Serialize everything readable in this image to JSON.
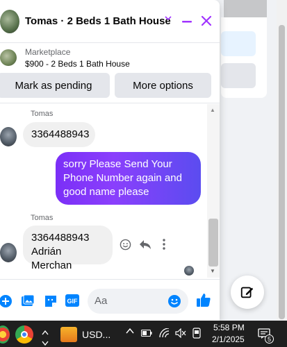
{
  "chat": {
    "title": "Tomas · 2 Beds 1 Bath House",
    "listing_source": "Marketplace",
    "listing_desc": "$900 - 2 Beds 1 Bath House",
    "mark_pending_label": "Mark as pending",
    "more_options_label": "More options"
  },
  "messages": {
    "sender1": "Tomas",
    "msg1": "3364488943",
    "outgoing": "sorry Please Send Your Phone Number again and good name please",
    "sender2": "Tomas",
    "msg2_line1": "3364488943",
    "msg2_line2": "Adrián Merchan"
  },
  "composer": {
    "placeholder": "Aa"
  },
  "taskbar": {
    "app_label": "USD...",
    "time": "5:58 PM",
    "date": "2/1/2025",
    "notification_count": "5"
  },
  "colors": {
    "accent": "#a033ff",
    "messenger_blue": "#0084ff",
    "outgoing_start": "#7b2ff7",
    "outgoing_end": "#5b4cf0"
  },
  "icons": [
    "minimize-icon",
    "close-icon",
    "chevron-down-icon",
    "plus-circle-icon",
    "photo-icon",
    "sticker-icon",
    "gif-icon",
    "emoji-icon",
    "like-icon",
    "reply-icon",
    "more-icon",
    "compose-icon"
  ]
}
